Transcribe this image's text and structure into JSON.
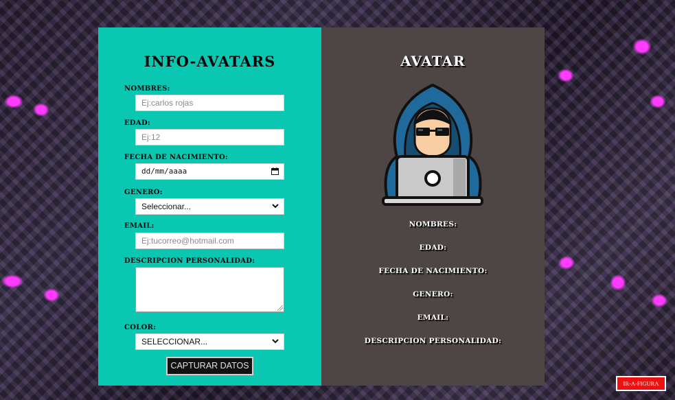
{
  "form": {
    "title": "INFO-AVATARS",
    "fields": {
      "nombres": {
        "label": "NOMBRES:",
        "placeholder": "Ej:carlos rojas"
      },
      "edad": {
        "label": "EDAD:",
        "placeholder": "Ej:12"
      },
      "fecha": {
        "label": "FECHA DE NACIMIENTO:",
        "value": "dd/mm/aaaa",
        "icon": "calendar-icon"
      },
      "genero": {
        "label": "GENERO:",
        "selected": "Seleccionar...",
        "icon": "chevron-down-icon"
      },
      "email": {
        "label": "EMAIL:",
        "placeholder": "Ej:tucorreo@hotmail.com"
      },
      "descripcion": {
        "label": "DESCRIPCION PERSONALIDAD:",
        "value": ""
      },
      "color": {
        "label": "COLOR:",
        "selected": "SELECCIONAR...",
        "icon": "chevron-down-icon"
      }
    },
    "submit_label": "CAPTURAR DATOS"
  },
  "avatar": {
    "title": "AVATAR",
    "image": "hacker-with-laptop-icon",
    "info_labels": [
      "NOMBRES:",
      "EDAD:",
      "FECHA DE NACIMIENTO:",
      "GENERO:",
      "EMAIL:",
      "DESCRIPCION PERSONALIDAD:"
    ]
  },
  "corner_button": {
    "label": "IR-A-FIGURA"
  },
  "colors": {
    "form_bg": "#0ac7b1",
    "avatar_bg": "#4e4545",
    "submit_bg": "#121212",
    "corner_button_bg": "#ee1111",
    "hood": "#1f6a9a"
  }
}
